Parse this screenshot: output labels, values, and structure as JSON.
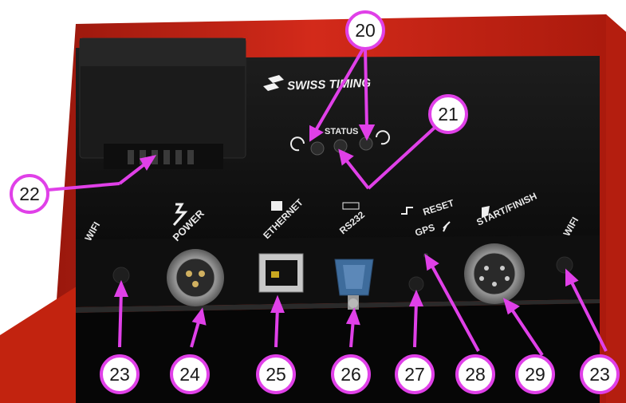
{
  "logo": {
    "text": "SWISS TIMING"
  },
  "panel_labels": {
    "status": "STATUS",
    "wifi_left": "WIFI",
    "power": "POWER",
    "ethernet": "ETHERNET",
    "rs232": "RS232",
    "reset": "RESET",
    "gps": "GPS",
    "start_finish": "START/FINISH",
    "wifi_right": "WIFI"
  },
  "callouts": {
    "c20": "20",
    "c21": "21",
    "c22": "22",
    "c23_left": "23",
    "c24": "24",
    "c25": "25",
    "c26": "26",
    "c27": "27",
    "c28": "28",
    "c29": "29",
    "c23_right": "23"
  },
  "colors": {
    "callout": "#e040e8",
    "housing": "#d42a1a",
    "panel": "#141414"
  }
}
